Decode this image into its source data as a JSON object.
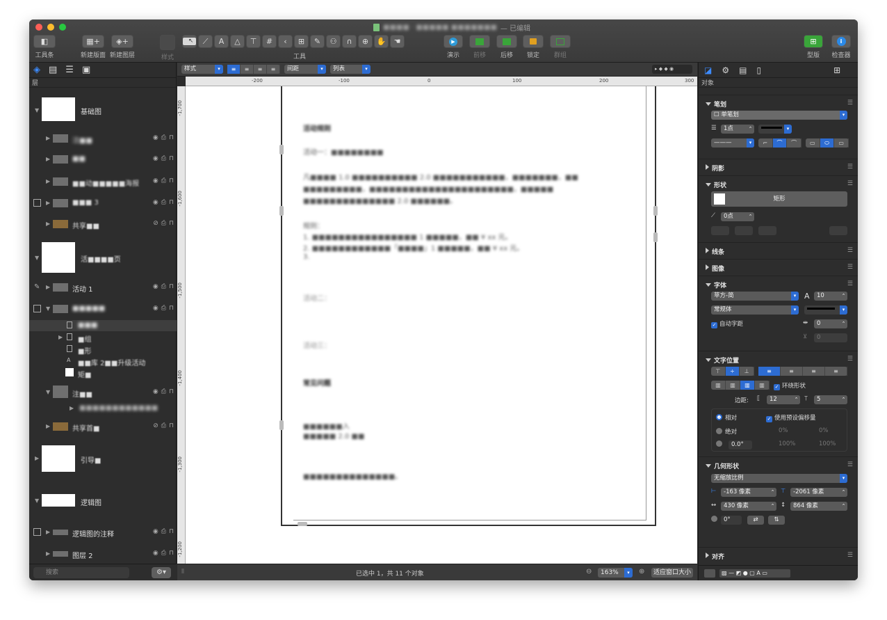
{
  "window": {
    "title_prefix": "■■■■ · ■■■■■ ■■■■■■■",
    "title_suffix": "— 已编辑"
  },
  "toolbar": {
    "sidebar": "工具条",
    "new_canvas": "新建版面",
    "new_layer": "新建图层",
    "style": "样式",
    "tools_label": "工具",
    "present": "演示",
    "forward": "前移",
    "backward": "后移",
    "lock": "锁定",
    "group": "群组",
    "stencils": "型版",
    "inspector": "检查器",
    "tool_icons": [
      "pointer-icon",
      "shape-icon",
      "line-icon",
      "text-icon",
      "pen-icon",
      "diagram-icon",
      "grid-icon",
      "bracket-icon",
      "hierarchy-icon",
      "brush-icon",
      "connect-icon",
      "magnet-icon",
      "magnify-icon",
      "hand-icon",
      "rubber-icon"
    ]
  },
  "layers_panel": {
    "header": "层",
    "search_placeholder": "搜索",
    "items": [
      {
        "label": "基础图",
        "type": "canvas"
      },
      {
        "label": "注■■",
        "type": "layer"
      },
      {
        "label": "■■",
        "type": "layer"
      },
      {
        "label": "■■动■■■■■海报",
        "type": "layer"
      },
      {
        "label": "■■■ 3",
        "type": "layer"
      },
      {
        "label": "共享■■",
        "type": "layer"
      },
      {
        "label": "活■■■■页",
        "type": "canvas"
      },
      {
        "label": "活动 1",
        "type": "layer"
      },
      {
        "label": "■■■■■",
        "type": "layer"
      },
      {
        "label": "■■■",
        "type": "object"
      },
      {
        "label": "■组",
        "type": "object"
      },
      {
        "label": "■形",
        "type": "object"
      },
      {
        "label": "■■库 2■■升级活动",
        "type": "object"
      },
      {
        "label": "矩■",
        "type": "object"
      },
      {
        "label": "注■■",
        "type": "layer"
      },
      {
        "label": "■■■■■■■■■■■■",
        "type": "object"
      },
      {
        "label": "共享首■",
        "type": "layer"
      },
      {
        "label": "引导■",
        "type": "canvas"
      },
      {
        "label": "逻辑图",
        "type": "canvas"
      },
      {
        "label": "逻辑图的注释",
        "type": "layer"
      },
      {
        "label": "图层 2",
        "type": "layer"
      }
    ]
  },
  "format_bar": {
    "style": "样式",
    "spacing": "间距",
    "list": "列表"
  },
  "ruler": {
    "h_ticks": [
      "-200",
      "-100",
      "0",
      "100",
      "200",
      "300"
    ],
    "v_ticks": [
      "-1,700",
      "-1,600",
      "-1,500",
      "-1,400",
      "-1,300",
      "-1,200"
    ]
  },
  "document": {
    "lines": [
      {
        "text": "活动规则",
        "style": "b"
      },
      {
        "text": "活动一：■■■■■■■■",
        "style": "n"
      },
      {
        "text": "凡■■■■ 1.0 ■■■■■■■■■■ 2.0 ■■■■■■■■■■■，■■■■■■■，■■",
        "style": "n"
      },
      {
        "text": "■■■■■■■■■，■■■■■■■■■■■■■■■■■■■■■■，■■■■■",
        "style": "n"
      },
      {
        "text": "■■■■■■■■■■■■■■ 2.0 ■■■■■■。",
        "style": "n"
      },
      {
        "text": "规则：",
        "style": "n"
      },
      {
        "text": "1. ■■■■■■■■■■■■■■■■ 1 ■■■■■，■■ ¥ xx 元。",
        "style": "n"
      },
      {
        "text": "2. ■■■■■■■■■■■■「■■■■」1 ■■■■■，■■ ¥ xx 元。",
        "style": "n"
      },
      {
        "text": "3.",
        "style": "n"
      },
      {
        "text": "活动二：",
        "style": "gray"
      },
      {
        "text": "活动三：",
        "style": "gray"
      },
      {
        "text": "常见问题",
        "style": "b"
      },
      {
        "text": "■■■■■■入",
        "style": "n"
      },
      {
        "text": "■■■■■ 2.0 ■■",
        "style": "n"
      },
      {
        "text": "■■■■■■■■■■■■■■。",
        "style": "n"
      }
    ]
  },
  "statusbar": {
    "selection": "已选中 1，共 11 个对象",
    "zoom": "163%",
    "fit": "适应窗口大小"
  },
  "inspector": {
    "header": "对象",
    "stroke": {
      "title": "笔划",
      "type": "单笔划",
      "width": "1点"
    },
    "shadow": {
      "title": "阴影"
    },
    "shape": {
      "title": "形状",
      "name": "矩形",
      "corner": "0点"
    },
    "lines": {
      "title": "线条"
    },
    "image": {
      "title": "图像"
    },
    "font": {
      "title": "字体",
      "family": "苹方-简",
      "size": "10",
      "weight": "常规体",
      "kerning_label": "自动字距",
      "kerning": "0",
      "baseline": "0"
    },
    "text_position": {
      "title": "文字位置",
      "wrap_label": "环绕形状",
      "margin_label": "边距:",
      "margin_left": "12",
      "margin_top": "5"
    },
    "offset": {
      "relative": "相对",
      "absolute": "绝对",
      "angle": "0.0°",
      "use_preset": "使用预设偏移量",
      "pct1": "0%",
      "pct2": "0%",
      "pct3": "100%",
      "pct4": "100%"
    },
    "geometry": {
      "title": "几何形状",
      "ratio": "无缩放比例",
      "x": "-163 像素",
      "y": "-2061 像素",
      "w": "430 像素",
      "h": "864 像素",
      "rotation": "0°"
    },
    "align": {
      "title": "对齐"
    }
  },
  "colors": {
    "accent": "#2d6cd2",
    "present": "#2e9bd8",
    "green": "#3aa53a",
    "lock": "#e0a020",
    "inspector": "#2b8ae8"
  }
}
